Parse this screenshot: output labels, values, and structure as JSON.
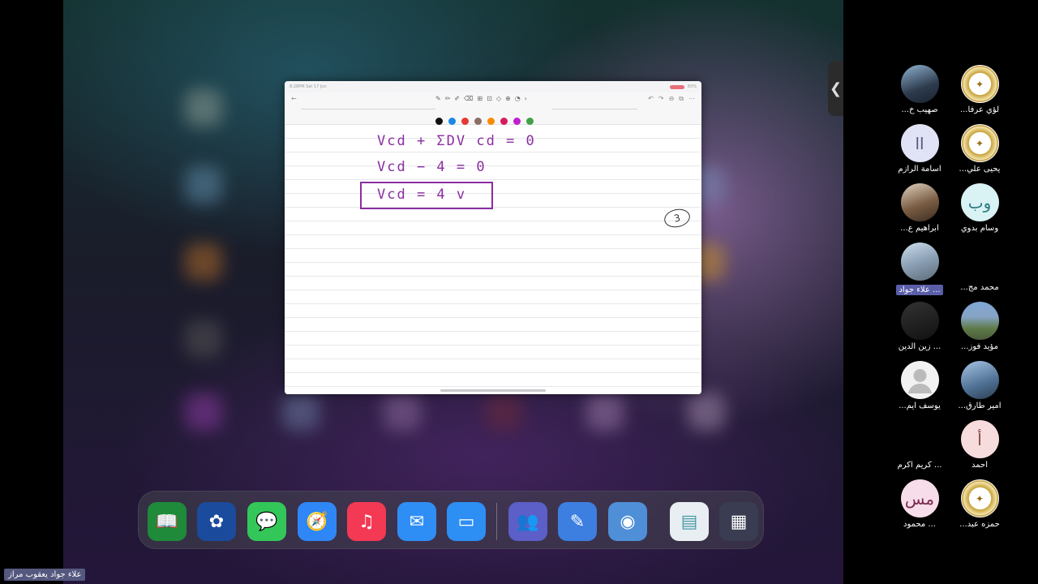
{
  "screen_share": {
    "status_time": "8:28PM  Sat 17 Jun",
    "status_battery": "83%",
    "toolbar_back": "←",
    "toolbar_more": "›",
    "toolbar_right_icons": [
      "↶",
      "↷",
      "⊖",
      "⧉",
      "⋯"
    ],
    "tool_icons": [
      "✎",
      "✏",
      "✐",
      "⌫",
      "⊞",
      "⊡",
      "◇",
      "⊕",
      "◔"
    ],
    "palette_colors": [
      "#111111",
      "#1e88e5",
      "#e53935",
      "#8d6e63",
      "#fb8c00",
      "#d81b60",
      "#c020d0",
      "#43a047"
    ],
    "handwriting": {
      "line1": "Vcd + ΣDV cd = 0",
      "line2": "Vcd − 4  =  0",
      "line3": "Vcd  =  4 v",
      "circled": "3"
    }
  },
  "dock_apps": [
    {
      "name": "Quran",
      "icon": "📖",
      "color": "#1f8a3a"
    },
    {
      "name": "Settings",
      "icon": "✿",
      "color": "#1a4b9c"
    },
    {
      "name": "Messages",
      "icon": "💬",
      "color": "#33c759"
    },
    {
      "name": "Safari",
      "icon": "🧭",
      "color": "#2f86f6"
    },
    {
      "name": "Music",
      "icon": "♫",
      "color": "#f43954"
    },
    {
      "name": "Mail",
      "icon": "✉",
      "color": "#2f8ef5"
    },
    {
      "name": "Files",
      "icon": "▭",
      "color": "#2d8ef3"
    },
    {
      "name": "Teams",
      "icon": "👥",
      "color": "#5b5fc7"
    },
    {
      "name": "Notes app",
      "icon": "✎",
      "color": "#3d7fe0"
    },
    {
      "name": "Camera app",
      "icon": "◉",
      "color": "#4f8fd8"
    },
    {
      "name": "Document",
      "icon": "▤",
      "color": "#e8eef2"
    },
    {
      "name": "App Library",
      "icon": "▦",
      "color": "#3a3d52"
    }
  ],
  "participants": [
    {
      "name": "...لؤي عرفا",
      "avatar": "seal",
      "initials": "✦"
    },
    {
      "name": "...صهيب خ",
      "avatar": "photo1",
      "initials": ""
    },
    {
      "name": "...يحيى علي",
      "avatar": "seal",
      "initials": "✦"
    },
    {
      "name": "اسامة الرازم",
      "avatar": "initials",
      "initials": "اا",
      "bg": "#dfe3f5",
      "fg": "#555a7a"
    },
    {
      "name": "وسام بدوي",
      "avatar": "initials",
      "initials": "وب",
      "bg": "#d9f2f4",
      "fg": "#2b7a80"
    },
    {
      "name": "...ابراهيم ع",
      "avatar": "photo2",
      "initials": ""
    },
    {
      "name": "...محمد مج",
      "avatar": "none",
      "initials": ""
    },
    {
      "name": "علاء جواد ...",
      "avatar": "photo3",
      "initials": "",
      "highlight": true
    },
    {
      "name": "...مؤيد فوز",
      "avatar": "photo5",
      "initials": ""
    },
    {
      "name": "زين الدين ...",
      "avatar": "photo4",
      "initials": ""
    },
    {
      "name": "...امير طارق",
      "avatar": "photo6",
      "initials": ""
    },
    {
      "name": "...يوسف ايم",
      "avatar": "user",
      "initials": ""
    },
    {
      "name": "أحمد",
      "avatar": "initials",
      "initials": "أ",
      "bg": "#f6dcdc",
      "fg": "#8a4040"
    },
    {
      "name": "كريم اكرم ...",
      "avatar": "none",
      "initials": ""
    },
    {
      "name": "...حمزه عبد",
      "avatar": "seal",
      "initials": "✦"
    },
    {
      "name": "محمود ...",
      "avatar": "initials",
      "initials": "مس",
      "bg": "#f7dde9",
      "fg": "#7a2a50"
    }
  ],
  "bottom_label": "علاء جواد يعقوب مراز",
  "side_handle": "❮"
}
